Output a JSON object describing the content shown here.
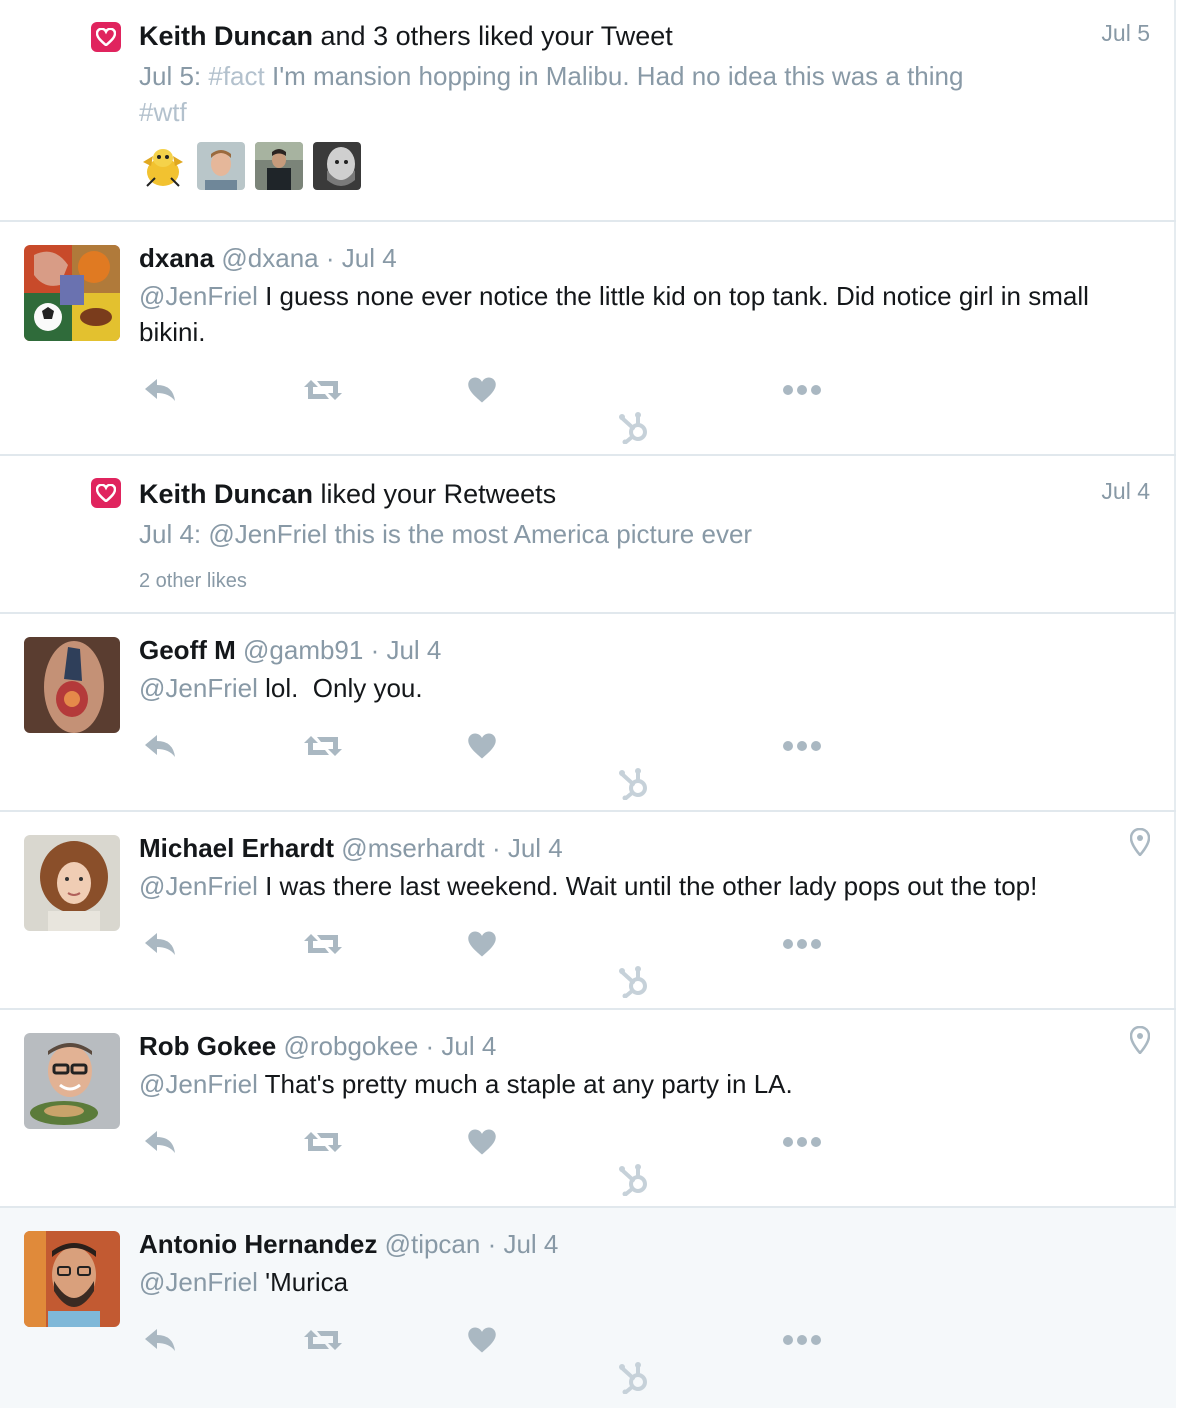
{
  "notifications": [
    {
      "actor": "Keith Duncan",
      "action": " and 3 others liked your Tweet",
      "date": "Jul 5",
      "prefix": "Jul 5: ",
      "tag1": "#fact",
      "text1": " I'm mansion hopping in Malibu. Had no idea this was a thing ",
      "tag2": "#wtf"
    },
    {
      "actor": "Keith Duncan",
      "action": " liked your Retweets",
      "date": "Jul 4",
      "prefix": "Jul 4: ",
      "mention": "@JenFriel",
      "text": " this is the most America picture ever",
      "other_likes": "2 other likes"
    }
  ],
  "tweets": [
    {
      "name": "dxana",
      "handle": "@dxana",
      "date": "· Jul 4",
      "mention": "@JenFriel",
      "text": " I guess none ever notice the little kid on top tank. Did notice girl in small bikini."
    },
    {
      "name": "Geoff M",
      "handle": "@gamb91",
      "date": " · Jul 4",
      "mention": "@JenFriel",
      "text": " lol.  Only you."
    },
    {
      "name": "Michael Erhardt",
      "handle": "@mserhardt",
      "date": "· Jul 4",
      "mention": "@JenFriel",
      "text": " I was there last weekend. Wait until the other lady pops out the top!"
    },
    {
      "name": "Rob Gokee",
      "handle": "@robgokee",
      "date": "· Jul 4",
      "mention": "@JenFriel",
      "text": " That's pretty much a staple at any party in LA."
    },
    {
      "name": "Antonio Hernandez",
      "handle": "@tipcan",
      "date": "· Jul 4",
      "mention": "@JenFriel",
      "text": " 'Murica"
    }
  ],
  "icons": {
    "reply": "reply-icon",
    "retweet": "retweet-icon",
    "like": "heart-icon",
    "more": "more-icon",
    "geo": "location-pin-icon",
    "hubspot": "hubspot-sprocket-icon",
    "like_badge": "heart-badge-icon"
  },
  "colors": {
    "accent_like": "#e0245e",
    "muted": "#8899a6",
    "icon_gray": "#aab8c2",
    "highlight_bg": "#f5f8fa"
  }
}
